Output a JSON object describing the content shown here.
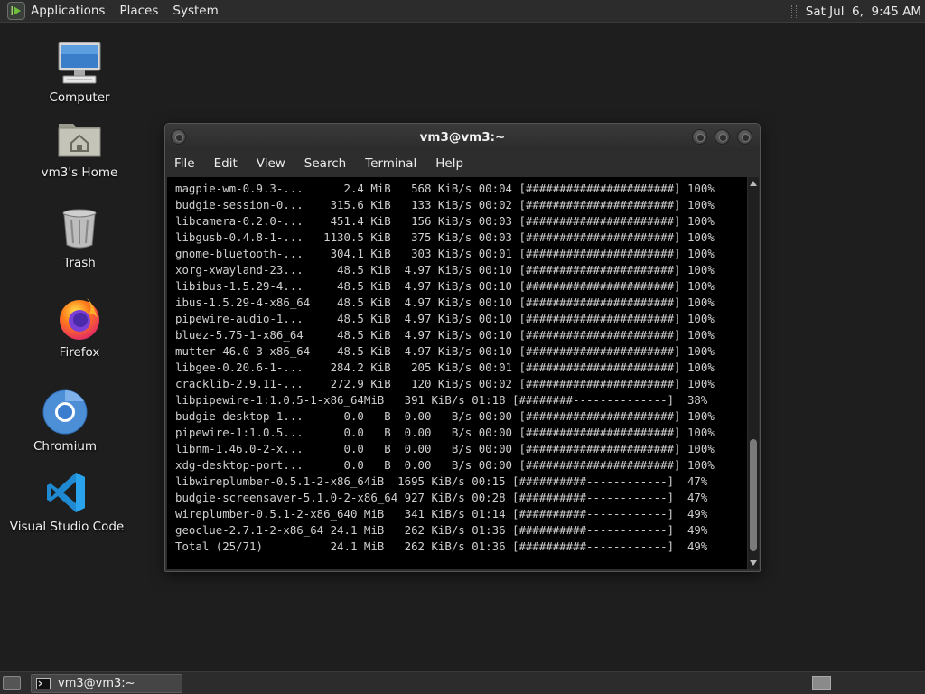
{
  "top_panel": {
    "menus": [
      "Applications",
      "Places",
      "System"
    ],
    "clock": "Sat Jul  6,  9:45 AM"
  },
  "desktop_icons": [
    {
      "label": "Computer",
      "icon": "computer-icon"
    },
    {
      "label": "vm3's Home",
      "icon": "home-folder-icon"
    },
    {
      "label": "Trash",
      "icon": "trash-icon"
    },
    {
      "label": "Firefox",
      "icon": "firefox-icon"
    },
    {
      "label": "Chromium",
      "icon": "chromium-icon"
    },
    {
      "label": "Visual Studio Code",
      "icon": "vscode-icon"
    }
  ],
  "terminal": {
    "title": "vm3@vm3:~",
    "menu": [
      "File",
      "Edit",
      "View",
      "Search",
      "Terminal",
      "Help"
    ],
    "lines": [
      "magpie-wm-0.9.3-...      2.4 MiB   568 KiB/s 00:04 [######################] 100%",
      "budgie-session-0...    315.6 KiB   133 KiB/s 00:02 [######################] 100%",
      "libcamera-0.2.0-...    451.4 KiB   156 KiB/s 00:03 [######################] 100%",
      "libgusb-0.4.8-1-...   1130.5 KiB   375 KiB/s 00:03 [######################] 100%",
      "gnome-bluetooth-...    304.1 KiB   303 KiB/s 00:01 [######################] 100%",
      "xorg-xwayland-23...     48.5 KiB  4.97 KiB/s 00:10 [######################] 100%",
      "libibus-1.5.29-4...     48.5 KiB  4.97 KiB/s 00:10 [######################] 100%",
      "ibus-1.5.29-4-x86_64    48.5 KiB  4.97 KiB/s 00:10 [######################] 100%",
      "pipewire-audio-1...     48.5 KiB  4.97 KiB/s 00:10 [######################] 100%",
      "bluez-5.75-1-x86_64     48.5 KiB  4.97 KiB/s 00:10 [######################] 100%",
      "mutter-46.0-3-x86_64    48.5 KiB  4.97 KiB/s 00:10 [######################] 100%",
      "libgee-0.20.6-1-...    284.2 KiB   205 KiB/s 00:01 [######################] 100%",
      "cracklib-2.9.11-...    272.9 KiB   120 KiB/s 00:02 [######################] 100%",
      "libpipewire-1:1.0.5-1-x86_64MiB   391 KiB/s 01:18 [########--------------]  38%",
      "budgie-desktop-1...      0.0   B  0.00   B/s 00:00 [######################] 100%",
      "pipewire-1:1.0.5...      0.0   B  0.00   B/s 00:00 [######################] 100%",
      "libnm-1.46.0-2-x...      0.0   B  0.00   B/s 00:00 [######################] 100%",
      "xdg-desktop-port...      0.0   B  0.00   B/s 00:00 [######################] 100%",
      "libwireplumber-0.5.1-2-x86_64iB  1695 KiB/s 00:15 [##########------------]  47%",
      "budgie-screensaver-5.1.0-2-x86_64 927 KiB/s 00:28 [##########------------]  47%",
      "wireplumber-0.5.1-2-x86_640 MiB   341 KiB/s 01:14 [##########------------]  49%",
      "geoclue-2.7.1-2-x86_64 24.1 MiB   262 KiB/s 01:36 [##########------------]  49%",
      "Total (25/71)          24.1 MiB   262 KiB/s 01:36 [##########------------]  49%"
    ]
  },
  "taskbar": {
    "task_label": "vm3@vm3:~"
  }
}
